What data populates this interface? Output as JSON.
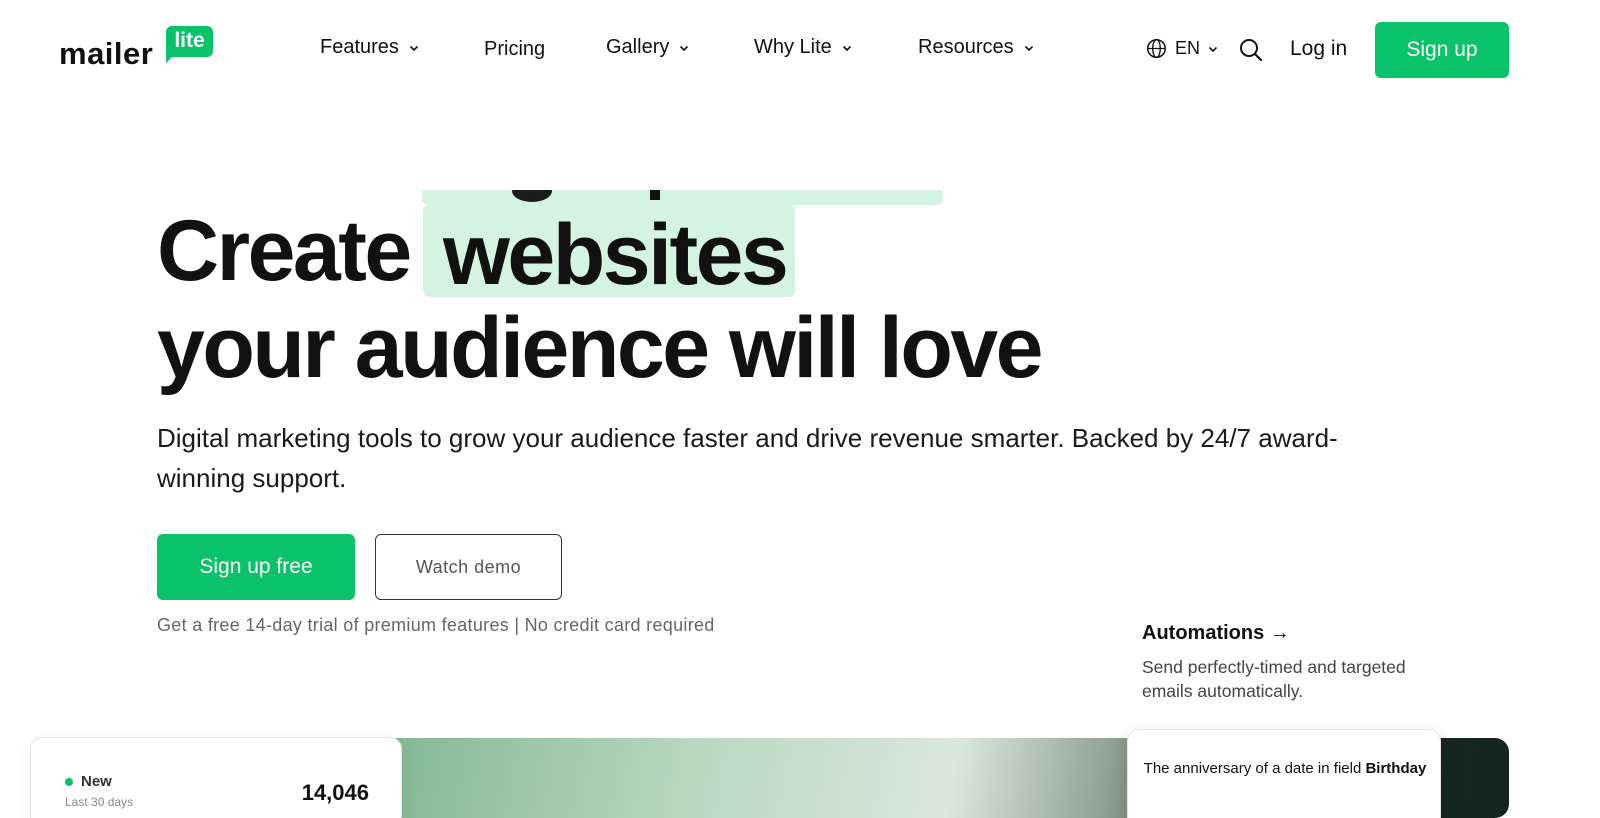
{
  "brand": {
    "word": "mailer",
    "badge": "lite",
    "accent": "#09c269",
    "highlight": "#d4f3e3"
  },
  "nav": {
    "items": [
      {
        "label": "Features",
        "dropdown": true
      },
      {
        "label": "Pricing",
        "dropdown": false
      },
      {
        "label": "Gallery",
        "dropdown": true
      },
      {
        "label": "Why Lite",
        "dropdown": true
      },
      {
        "label": "Resources",
        "dropdown": true
      }
    ],
    "language": "EN",
    "search_icon": "search-icon",
    "login": "Log in",
    "signup": "Sign up"
  },
  "hero": {
    "line1_prefix": "Create",
    "rotating_word": "websites",
    "line2": "your audience will love",
    "subtitle": "Digital marketing tools to grow your audience faster and drive revenue smarter. Backed by 24/7 award-winning support.",
    "cta_primary": "Sign up free",
    "cta_secondary": "Watch demo",
    "note": "Get a free 14-day trial of premium features | No credit card required"
  },
  "feature_callout": {
    "title": "Automations →",
    "description": "Send perfectly-timed and targeted emails automatically."
  },
  "preview": {
    "stat_card": {
      "label": "New",
      "period": "Last 30 days",
      "value": "14,046"
    },
    "trigger_card": {
      "text": "The anniversary of a date in field",
      "field": "Birthday"
    }
  }
}
